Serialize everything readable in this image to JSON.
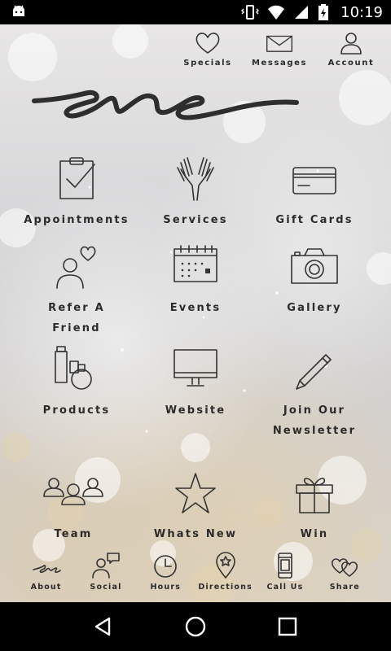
{
  "status_bar": {
    "time": "10:19"
  },
  "top_nav": [
    {
      "label": "Specials",
      "icon": "heart-icon"
    },
    {
      "label": "Messages",
      "icon": "envelope-icon"
    },
    {
      "label": "Account",
      "icon": "person-icon"
    }
  ],
  "logo": {
    "text": "eve"
  },
  "grid": [
    {
      "label": "Appointments",
      "icon": "clipboard-check-icon"
    },
    {
      "label": "Services",
      "icon": "open-hands-icon"
    },
    {
      "label": "Gift Cards",
      "icon": "credit-card-icon"
    },
    {
      "label": "Refer A\nFriend",
      "icon": "person-heart-icon"
    },
    {
      "label": "Events",
      "icon": "calendar-icon"
    },
    {
      "label": "Gallery",
      "icon": "camera-icon"
    },
    {
      "label": "Products",
      "icon": "cosmetics-icon"
    },
    {
      "label": "Website",
      "icon": "monitor-icon"
    },
    {
      "label": "Join Our\nNewsletter",
      "icon": "pencil-icon"
    },
    {
      "label": "Team",
      "icon": "group-icon"
    },
    {
      "label": "Whats New",
      "icon": "star-icon"
    },
    {
      "label": "Win",
      "icon": "gift-icon"
    }
  ],
  "bottom_nav": [
    {
      "label": "About",
      "icon": "eve-logo-icon"
    },
    {
      "label": "Social",
      "icon": "person-chat-icon"
    },
    {
      "label": "Hours",
      "icon": "clock-icon"
    },
    {
      "label": "Directions",
      "icon": "map-pin-star-icon"
    },
    {
      "label": "Call Us",
      "icon": "phone-icon"
    },
    {
      "label": "Share",
      "icon": "hearts-icon"
    }
  ],
  "colors": {
    "text": "#2b2b2b",
    "icon_stroke": "#333333",
    "status_bar": "#000000"
  }
}
